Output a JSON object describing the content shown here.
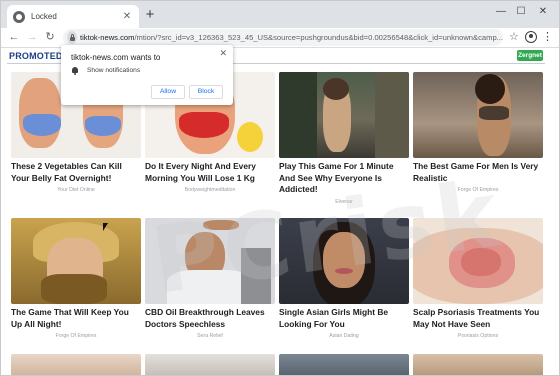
{
  "browser": {
    "tab": {
      "title": "Locked",
      "close": "✕"
    },
    "new_tab": "+",
    "window_controls": {
      "minimize": "—",
      "maximize": "☐",
      "close": "✕"
    },
    "toolbar": {
      "back": "←",
      "forward": "→",
      "reload": "↻",
      "star": "☆",
      "menu": "⋮"
    },
    "url": {
      "host": "tiktok-news.com",
      "rest": "/mtion/?src_id=v3_126363_523_45_US&source=pushgroundus&bid=0.00256548&click_id=unknown&camp..."
    }
  },
  "page": {
    "section_label": "PROMOTED CONTENT",
    "brand_badge": "Zergnet",
    "watermark": "PCrisk"
  },
  "notification": {
    "title": "tiktok-news.com wants to",
    "permission": "Show notifications",
    "allow": "Allow",
    "block": "Block",
    "close": "✕"
  },
  "cards": [
    {
      "headline": "These 2 Vegetables Can Kill Your Belly Fat Overnight!",
      "source": "Your Diet Online"
    },
    {
      "headline": "Do It Every Night And Every Morning You Will Lose 1 Kg",
      "source": "Bodyweightmeditation"
    },
    {
      "headline": "Play This Game For 1 Minute And See Why Everyone Is Addicted!",
      "source": "Elvenar"
    },
    {
      "headline": "The Best Game For Men Is Very Realistic",
      "source": "Forge Of Empires"
    },
    {
      "headline": "The Game That Will Keep You Up All Night!",
      "source": "Forge Of Empires"
    },
    {
      "headline": "CBD Oil Breakthrough Leaves Doctors Speechless",
      "source": "Sera Relief"
    },
    {
      "headline": "Single Asian Girls Might Be Looking For You",
      "source": "Asian Dating"
    },
    {
      "headline": "Scalp Psoriasis Treatments You May Not Have Seen",
      "source": "Psoriasis Options"
    }
  ],
  "colors": {
    "chrome_tabstrip": "#dee1e6",
    "omnibox": "#f1f3f4",
    "section_label": "#1a3f86",
    "brand_badge": "#32a852",
    "button_text": "#1a73e8"
  }
}
